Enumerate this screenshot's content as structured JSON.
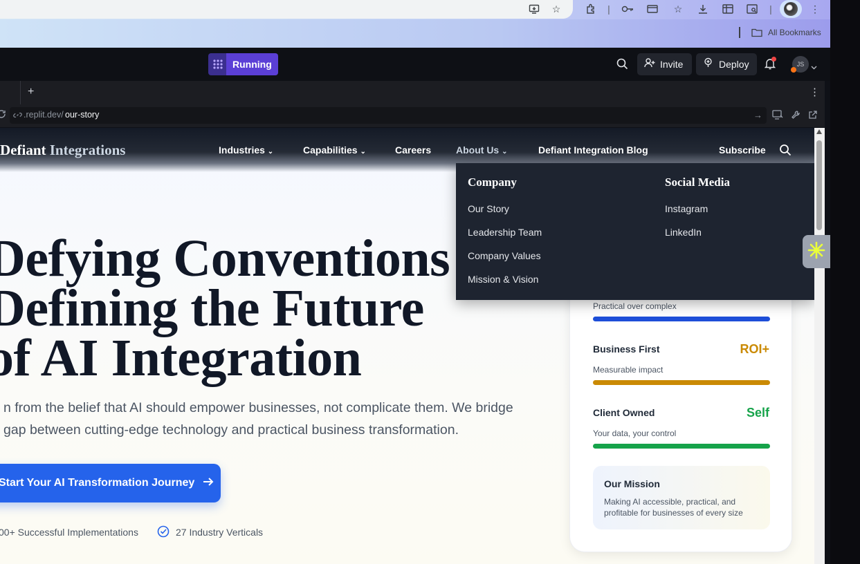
{
  "browser": {
    "bookmarks_label": "All Bookmarks",
    "avatar_initials": "JS"
  },
  "replit": {
    "status": "Running",
    "invite": "Invite",
    "deploy": "Deploy",
    "new_tab": "+",
    "url_prefix": ".replit.dev/",
    "url_path": "our-story"
  },
  "site": {
    "brand_bold": "Defiant",
    "brand_light": "Integrations",
    "nav": {
      "industries": "Industries",
      "capabilities": "Capabilities",
      "careers": "Careers",
      "about": "About Us",
      "blog": "Defiant Integration Blog",
      "subscribe": "Subscribe"
    },
    "dropdown": {
      "company_title": "Company",
      "company_items": [
        "Our Story",
        "Leadership Team",
        "Company Values",
        "Mission & Vision"
      ],
      "social_title": "Social Media",
      "social_items": [
        "Instagram",
        "LinkedIn"
      ]
    },
    "hero": {
      "line1": "Defying Conventions",
      "line2": "Defining the Future",
      "line3": "of AI Integration",
      "para1": "n from the belief that AI should empower businesses, not complicate them. We bridge",
      "para2": "gap between cutting-edge technology and practical business transformation.",
      "cta": "Start Your AI Transformation Journey",
      "stat1": "00+ Successful Implementations",
      "stat2": "27 Industry Verticals"
    },
    "card": {
      "practical_sub": "Practical over complex",
      "items": [
        {
          "title": "Business First",
          "value": "ROI+",
          "sub": "Measurable impact",
          "color": "#ca8a04"
        },
        {
          "title": "Client Owned",
          "value": "Self",
          "sub": "Your data, your control",
          "color": "#16a34a"
        }
      ],
      "practical_color": "#1d4ed8",
      "mission_title": "Our Mission",
      "mission_text_1": "Making AI accessible, practical, and",
      "mission_text_2": "profitable for businesses of every size"
    }
  }
}
